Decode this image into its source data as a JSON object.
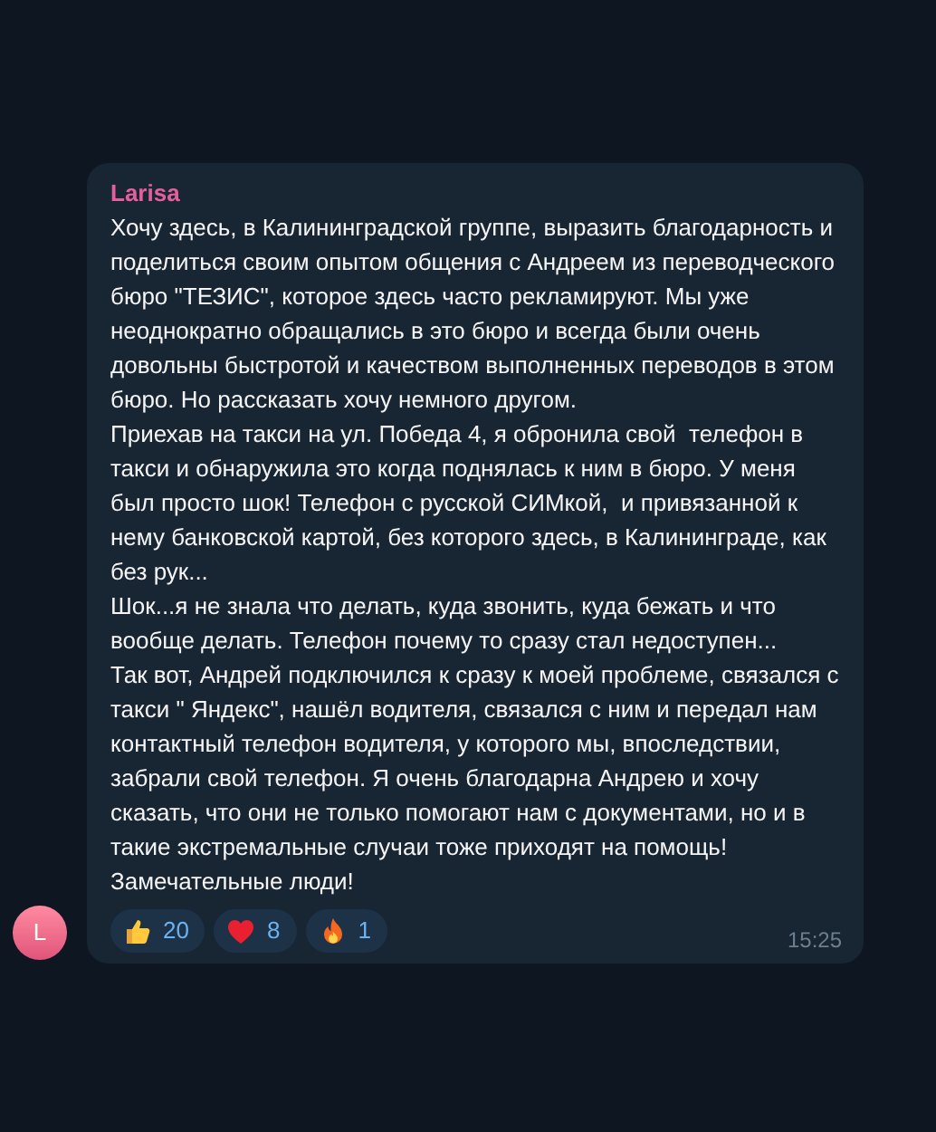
{
  "message": {
    "author": "Larisa",
    "avatar_initial": "L",
    "paragraphs": [
      "Хочу здесь, в Калининградской группе, выразить благодарность и поделиться своим опытом общения с Андреем из переводческого бюро \"ТЕЗИС\", которое здесь часто рекламируют. Мы уже неоднократно обращались в это бюро и всегда были очень довольны быстротой и качеством выполненных переводов в этом бюро. Но рассказать хочу немного другом.",
      "Приехав на такси на ул. Победа 4, я обронила свой  телефон в такси и обнаружила это когда поднялась к ним в бюро. У меня был просто шок! Телефон с русской СИМкой,  и привязанной к нему банковской картой, без которого здесь, в Калининграде, как без рук...",
      "Шок...я не знала что делать, куда звонить, куда бежать и что вообще делать. Телефон почему то сразу стал недоступен...",
      "Так вот, Андрей подключился к сразу к моей проблеме, связался с такси \" Яндекс\", нашёл водителя, связался с ним и передал нам контактный телефон водителя, у которого мы, впоследствии, забрали свой телефон. Я очень благодарна Андрею и хочу сказать, что они не только помогают нам с документами, но и в такие экстремальные случаи тоже приходят на помощь! Замечательные люди!"
    ],
    "reactions": [
      {
        "kind": "thumbs_up",
        "count": "20"
      },
      {
        "kind": "heart",
        "count": "8"
      },
      {
        "kind": "fire",
        "count": "1"
      }
    ],
    "time": "15:25"
  }
}
